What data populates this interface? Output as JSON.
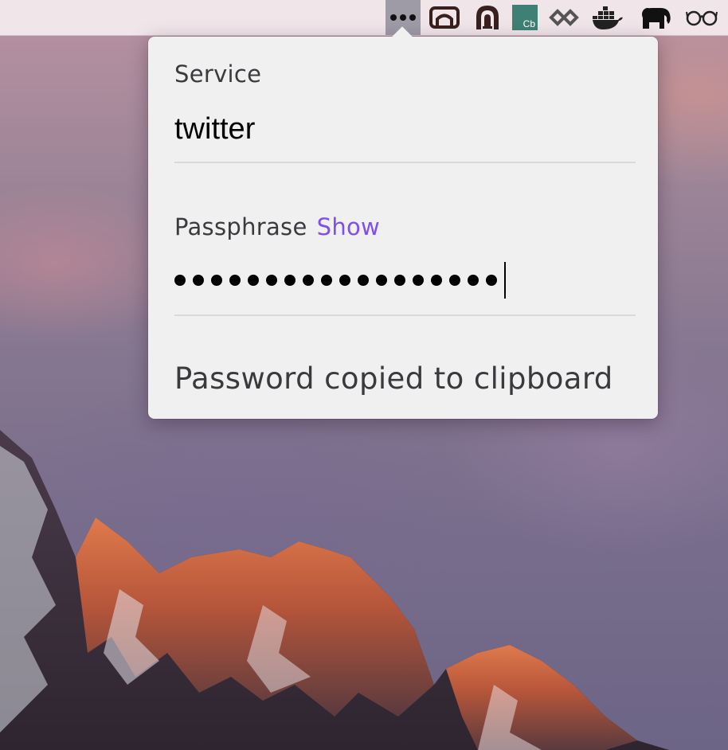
{
  "menubar": {
    "icons": [
      {
        "name": "more-dots-icon",
        "active": true
      },
      {
        "name": "bridge-icon"
      },
      {
        "name": "tunnel-icon"
      },
      {
        "name": "cb-app-icon",
        "label": "Cb"
      },
      {
        "name": "linked-diamonds-icon"
      },
      {
        "name": "docker-whale-icon"
      },
      {
        "name": "elephant-icon"
      },
      {
        "name": "glasses-icon"
      }
    ]
  },
  "popover": {
    "service": {
      "label": "Service",
      "value": "twitter"
    },
    "passphrase": {
      "label": "Passphrase",
      "show_label": "Show",
      "masked_length": 18
    },
    "status": "Password copied to clipboard"
  },
  "colors": {
    "accent": "#7f4ef0",
    "cb_icon_bg": "#3e8074"
  }
}
